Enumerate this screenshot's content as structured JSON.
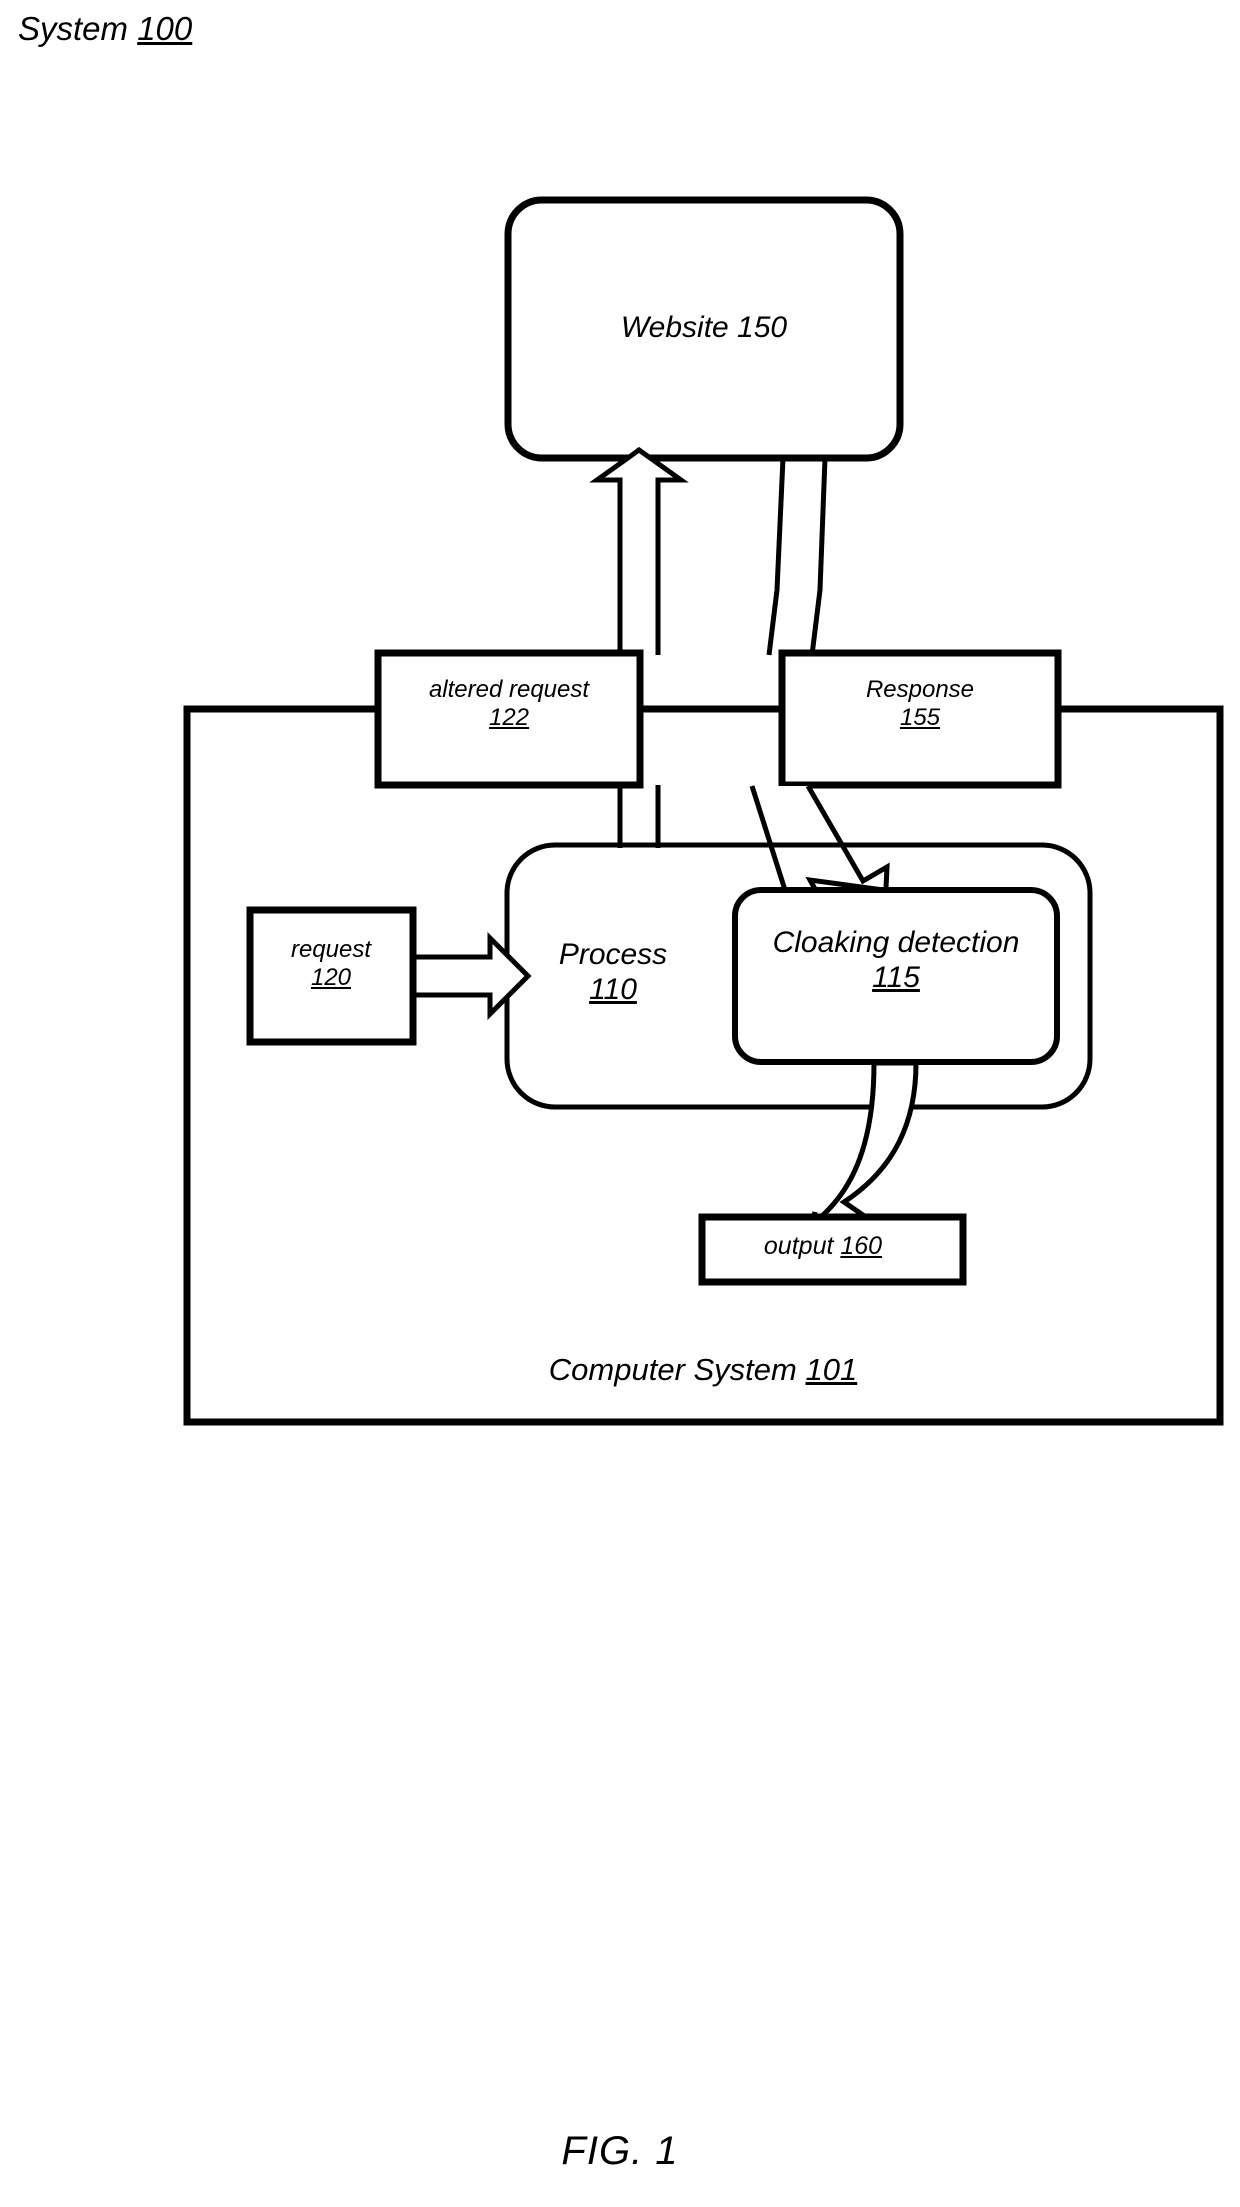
{
  "figure": {
    "title": "System",
    "title_ref": "100",
    "caption": "FIG. 1"
  },
  "nodes": {
    "website": {
      "label": "Website 150",
      "shape": "rounded-rect"
    },
    "altered_request": {
      "label": "altered request",
      "ref": "122",
      "shape": "rect"
    },
    "response": {
      "label": "Response",
      "ref": "155",
      "shape": "rect"
    },
    "request": {
      "label": "request",
      "ref": "120",
      "shape": "rect"
    },
    "process": {
      "label": "Process",
      "ref": "110",
      "shape": "rounded-rect"
    },
    "cloaking_detection": {
      "label": "Cloaking detection",
      "ref": "115",
      "shape": "rounded-rect"
    },
    "output": {
      "label": "output",
      "ref": "160",
      "shape": "rect"
    },
    "computer_system": {
      "label": "Computer System",
      "ref": "101",
      "shape": "rect"
    }
  },
  "edges": [
    {
      "name": "request-to-process",
      "from": "request",
      "to": "process",
      "style": "block-arrow",
      "direction": "right"
    },
    {
      "name": "process-to-altered-request",
      "from": "process",
      "to": "altered_request",
      "style": "block-arrow",
      "direction": "up"
    },
    {
      "name": "altered-request-to-website",
      "from": "altered_request",
      "to": "website",
      "style": "block-arrow",
      "direction": "up"
    },
    {
      "name": "website-to-response",
      "from": "website",
      "to": "response",
      "style": "block-line",
      "direction": "down"
    },
    {
      "name": "response-to-cloaking-detection",
      "from": "response",
      "to": "cloaking_detection",
      "style": "block-arrow",
      "direction": "down-left"
    },
    {
      "name": "cloaking-detection-to-output",
      "from": "cloaking_detection",
      "to": "output",
      "style": "curved-block-arrow",
      "direction": "down-left"
    }
  ],
  "colors": {
    "stroke": "#000000",
    "background": "#ffffff"
  }
}
